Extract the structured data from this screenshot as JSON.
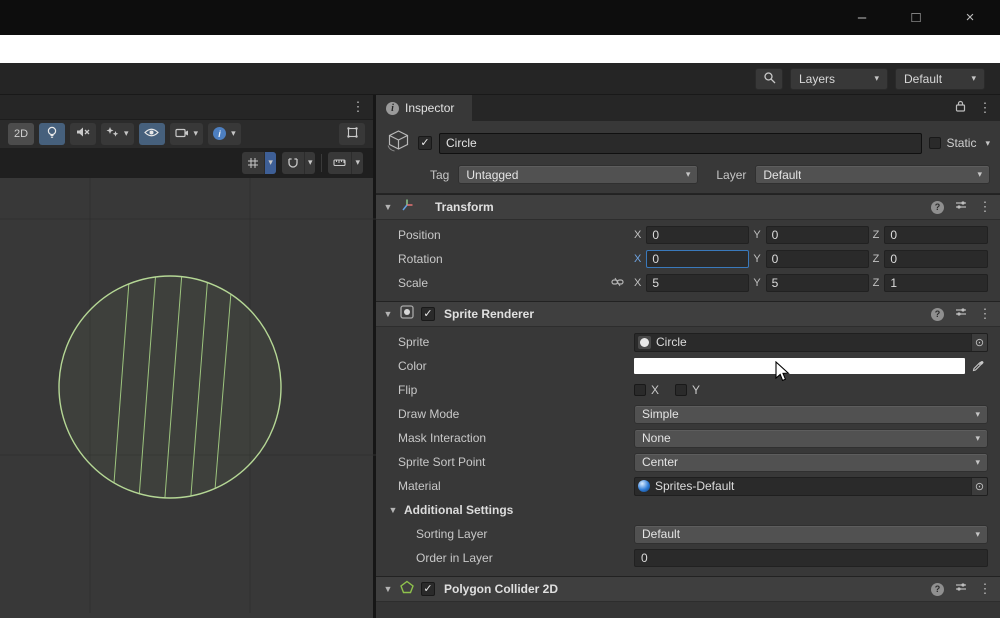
{
  "icons": {
    "minimize": "–",
    "maximize": "□",
    "close": "×",
    "caret": "▾",
    "fold": "▼",
    "kebab": "⋮",
    "check": "✓",
    "picker": "⊙",
    "info": "i",
    "help": "?"
  },
  "topbar": {
    "layers_dropdown": "Layers",
    "layout_dropdown": "Default"
  },
  "scene_view": {
    "mode_2d_button": "2D"
  },
  "inspector": {
    "tab": "Inspector",
    "header": {
      "name": "Circle",
      "static_label": "Static",
      "tag_label": "Tag",
      "tag_value": "Untagged",
      "layer_label": "Layer",
      "layer_value": "Default"
    },
    "transform": {
      "title": "Transform",
      "axis_x": "X",
      "axis_y": "Y",
      "axis_z": "Z",
      "rows": [
        {
          "label": "Position",
          "x": "0",
          "y": "0",
          "z": "0"
        },
        {
          "label": "Rotation",
          "x": "0",
          "y": "0",
          "z": "0"
        },
        {
          "label": "Scale",
          "x": "5",
          "y": "5",
          "z": "1"
        }
      ]
    },
    "sprite_renderer": {
      "title": "Sprite Renderer",
      "sprite_label": "Sprite",
      "sprite_value": "Circle",
      "color_label": "Color",
      "flip_label": "Flip",
      "flip_x": "X",
      "flip_y": "Y",
      "draw_mode_label": "Draw Mode",
      "draw_mode_value": "Simple",
      "mask_interaction_label": "Mask Interaction",
      "mask_interaction_value": "None",
      "sprite_sort_point_label": "Sprite Sort Point",
      "sprite_sort_point_value": "Center",
      "material_label": "Material",
      "material_value": "Sprites-Default",
      "additional_settings_label": "Additional Settings",
      "sorting_layer_label": "Sorting Layer",
      "sorting_layer_value": "Default",
      "order_in_layer_label": "Order in Layer",
      "order_in_layer_value": "0"
    },
    "polygon_collider": {
      "title": "Polygon Collider 2D"
    }
  },
  "colors": {
    "accent_focus": "#3a79bb",
    "toggle_active": "#46607c",
    "circle_stroke": "#b5d795",
    "panel_bg": "#383838"
  }
}
